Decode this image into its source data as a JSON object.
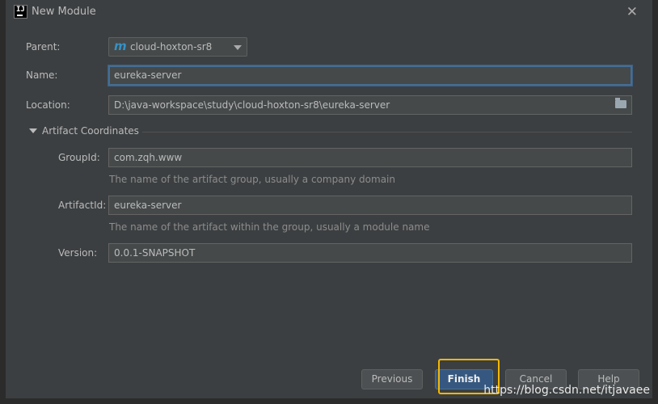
{
  "window": {
    "title": "New Module",
    "app_icon_text": "IJ"
  },
  "form": {
    "parent": {
      "label": "Parent:",
      "value": "cloud-hoxton-sr8",
      "icon": "maven-m-icon"
    },
    "name": {
      "label": "Name:",
      "value": "eureka-server"
    },
    "location": {
      "label": "Location:",
      "value": "D:\\java-workspace\\study\\cloud-hoxton-sr8\\eureka-server"
    }
  },
  "artifact": {
    "section_title": "Artifact Coordinates",
    "group_id": {
      "label": "GroupId:",
      "value": "com.zqh.www",
      "hint": "The name of the artifact group, usually a company domain"
    },
    "artifact_id": {
      "label": "ArtifactId:",
      "value": "eureka-server",
      "hint": "The name of the artifact within the group, usually a module name"
    },
    "version": {
      "label": "Version:",
      "value": "0.0.1-SNAPSHOT"
    }
  },
  "buttons": {
    "previous": "Previous",
    "finish": "Finish",
    "cancel": "Cancel",
    "help": "Help"
  },
  "watermark": "https://blog.csdn.net/itjavaee",
  "colors": {
    "background": "#3c3f41",
    "field": "#45494a",
    "focus_border": "#466d94",
    "default_button": "#365880",
    "highlight": "#f5b800"
  }
}
